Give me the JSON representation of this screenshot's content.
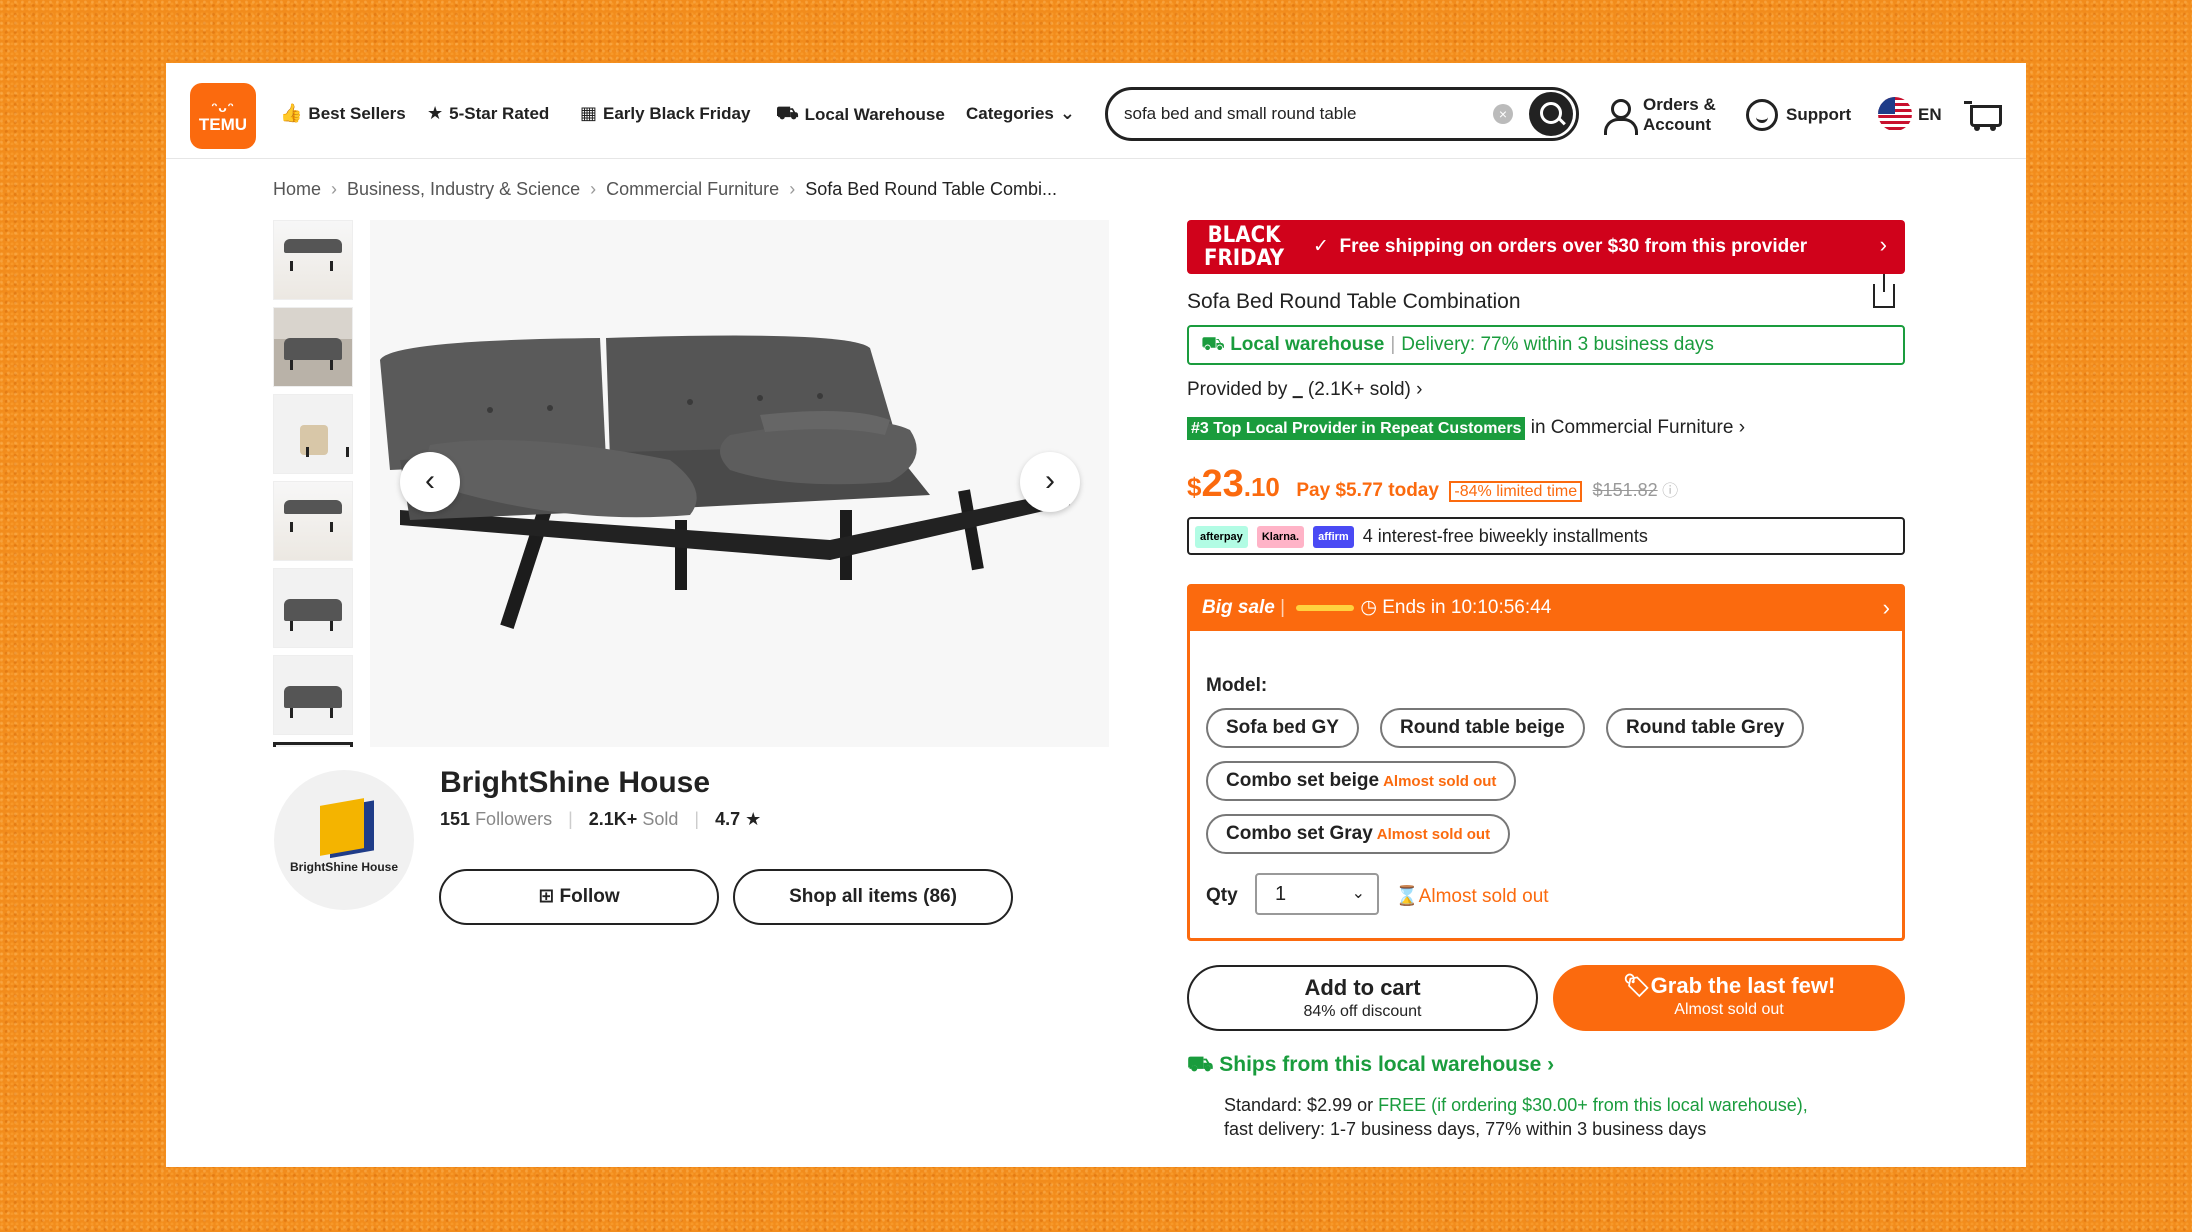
{
  "header": {
    "logo_text": "TEMU",
    "nav": [
      {
        "label": "Best Sellers",
        "icon": "thumbs-up-icon"
      },
      {
        "label": "5-Star Rated",
        "icon": "star-badge-icon"
      },
      {
        "label": "Early Black Friday",
        "icon": "calendar-icon"
      },
      {
        "label": "Local Warehouse",
        "icon": "truck-icon"
      },
      {
        "label": "Categories",
        "icon": "chevron-down-icon"
      }
    ],
    "search": {
      "query": "sofa bed and small round table"
    },
    "orders_line1": "Orders &",
    "orders_line2": "Account",
    "support": "Support",
    "language": "EN"
  },
  "breadcrumbs": [
    "Home",
    "Business, Industry & Science",
    "Commercial Furniture",
    "Sofa Bed Round Table Combi..."
  ],
  "store": {
    "logo_text": "BrightShine House",
    "name": "BrightShine House",
    "followers_count": "151",
    "followers_label": "Followers",
    "sold_count": "2.1K+",
    "sold_label": "Sold",
    "rating": "4.7",
    "follow_label": "Follow",
    "shop_all_label": "Shop all items (86)"
  },
  "product": {
    "banner_tag_1": "BLACK",
    "banner_tag_2": "FRIDAY",
    "banner_msg": "Free shipping on orders over $30 from this provider",
    "title": "Sofa Bed Round Table Combination",
    "local_warehouse": "Local warehouse",
    "delivery": "Delivery: 77% within 3 business days",
    "provided_by": "Provided by",
    "provided_sold": "(2.1K+ sold)",
    "rank_badge": "#3 Top Local Provider in Repeat Customers",
    "rank_in": "in Commercial Furniture",
    "price_dollar": "$",
    "price_whole": "23",
    "price_cents": ".10",
    "pay_today": "Pay $5.77 today",
    "discount": "-84% limited time",
    "original_price": "$151.82",
    "installments": "4 interest-free biweekly installments",
    "pay_providers": [
      "afterpay",
      "Klarna.",
      "affirm"
    ]
  },
  "sale": {
    "title": "Big sale",
    "ends": "Ends in 10:10:56:44",
    "model_label": "Model:",
    "options": [
      {
        "label": "Sofa bed GY",
        "note": ""
      },
      {
        "label": "Round table beige",
        "note": ""
      },
      {
        "label": "Round table Grey",
        "note": ""
      },
      {
        "label": "Combo set beige",
        "note": "Almost sold out"
      },
      {
        "label": "Combo set Gray",
        "note": "Almost sold out"
      }
    ],
    "qty_label": "Qty",
    "qty_value": "1",
    "qty_note": "Almost sold out"
  },
  "actions": {
    "add_to_cart": "Add to cart",
    "add_to_cart_sub": "84% off discount",
    "grab": "Grab the last few!",
    "grab_sub": "Almost sold out"
  },
  "shipping": {
    "ships_from": "Ships from this local warehouse",
    "standard_1": "Standard: $2.99 or ",
    "free_text": "FREE (if ordering $30.00+ from this local warehouse),",
    "standard_2": "fast delivery: 1-7 business days, 77% within 3 business days"
  },
  "colors": {
    "accent": "#fb6a0e",
    "green": "#1a9c3d",
    "red": "#d0021b",
    "background": "#f28c1c"
  }
}
